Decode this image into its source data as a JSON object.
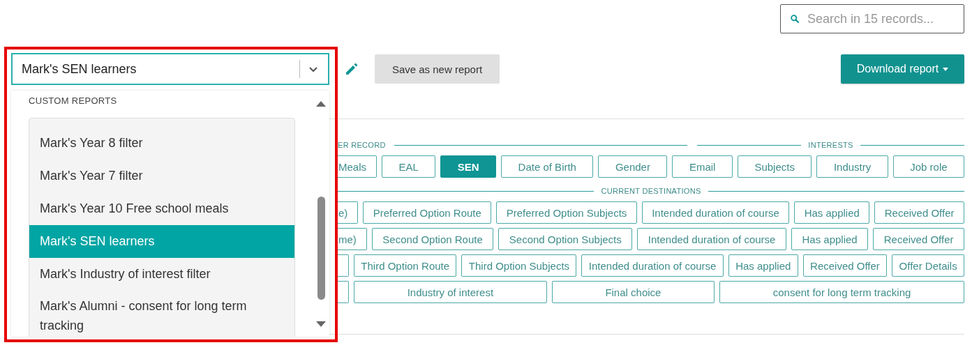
{
  "search": {
    "placeholder": "Search in 15 records..."
  },
  "report_select": {
    "value": "Mark's SEN learners"
  },
  "save_button": "Save as new report",
  "download_button": "Download report",
  "dropdown": {
    "group": "CUSTOM REPORTS",
    "items": [
      {
        "label": "Mark's Year 8 filter",
        "selected": false
      },
      {
        "label": "Mark's Year 7 filter",
        "selected": false
      },
      {
        "label": "Mark's Year 10 Free school meals",
        "selected": false
      },
      {
        "label": "Mark's SEN learners",
        "selected": true
      },
      {
        "label": "Mark's Industry of interest filter",
        "selected": false
      },
      {
        "label": "Mark's Alumni - consent for long term tracking",
        "selected": false
      }
    ]
  },
  "field_rows": [
    {
      "kind": "header",
      "headers": [
        {
          "title": "ER RECORD",
          "cut": true
        },
        {
          "title": "INTERESTS",
          "cut": false
        }
      ]
    },
    {
      "kind": "chips",
      "chips": [
        {
          "label": "Meals",
          "cut": true,
          "selected": false
        },
        {
          "label": "EAL",
          "cut": false,
          "selected": false
        },
        {
          "label": "SEN",
          "cut": false,
          "selected": true
        },
        {
          "label": "Date of Birth",
          "cut": false,
          "selected": false
        },
        {
          "label": "Gender",
          "cut": false,
          "selected": false
        },
        {
          "label": "Email",
          "cut": false,
          "selected": false
        },
        {
          "label": "Subjects",
          "cut": false,
          "selected": false
        },
        {
          "label": "Industry",
          "cut": false,
          "selected": false
        },
        {
          "label": "Job role",
          "cut": false,
          "selected": false
        }
      ]
    },
    {
      "kind": "header",
      "headers": [
        {
          "title": "CURRENT DESTINATIONS",
          "cut": false
        }
      ]
    },
    {
      "kind": "chips",
      "chips": [
        {
          "label": "e)",
          "cut": true,
          "selected": false
        },
        {
          "label": "Preferred Option Route",
          "cut": false,
          "selected": false
        },
        {
          "label": "Preferred Option Subjects",
          "cut": false,
          "selected": false
        },
        {
          "label": "Intended duration of course",
          "cut": false,
          "selected": false
        },
        {
          "label": "Has applied",
          "cut": false,
          "selected": false
        },
        {
          "label": "Received Offer",
          "cut": false,
          "selected": false
        }
      ]
    },
    {
      "kind": "chips",
      "chips": [
        {
          "label": "me)",
          "cut": true,
          "selected": false
        },
        {
          "label": "Second Option Route",
          "cut": false,
          "selected": false
        },
        {
          "label": "Second Option Subjects",
          "cut": false,
          "selected": false
        },
        {
          "label": "Intended duration of course",
          "cut": false,
          "selected": false
        },
        {
          "label": "Has applied",
          "cut": false,
          "selected": false
        },
        {
          "label": "Received Offer",
          "cut": false,
          "selected": false
        }
      ]
    },
    {
      "kind": "chips",
      "chips": [
        {
          "cut": true,
          "selected": false
        },
        {
          "label": "Third Option Route",
          "cut": false,
          "selected": false
        },
        {
          "label": "Third Option Subjects",
          "cut": false,
          "selected": false
        },
        {
          "label": "Intended duration of course",
          "cut": false,
          "selected": false
        },
        {
          "label": "Has applied",
          "cut": false,
          "selected": false
        },
        {
          "label": "Received Offer",
          "cut": false,
          "selected": false
        },
        {
          "label": "Offer Details",
          "cut": false,
          "selected": false
        }
      ]
    },
    {
      "kind": "chips",
      "chips": [
        {
          "cut": true,
          "selected": false
        },
        {
          "label": "Industry of interest",
          "cut": false,
          "selected": false
        },
        {
          "label": "Final choice",
          "cut": false,
          "selected": false
        },
        {
          "label": "consent for long term tracking",
          "cut": false,
          "selected": false
        }
      ]
    }
  ]
}
